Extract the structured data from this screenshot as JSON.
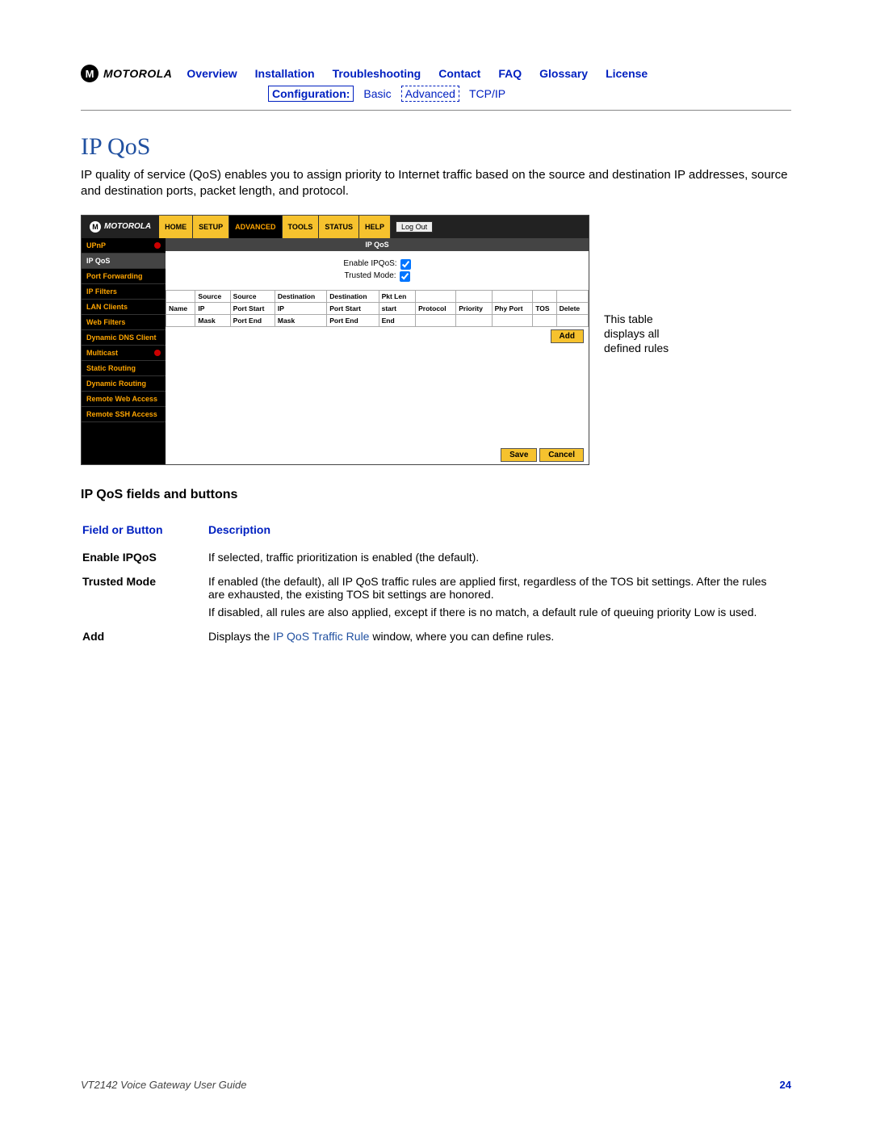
{
  "brand": "MOTOROLA",
  "top_nav": [
    "Overview",
    "Installation",
    "Troubleshooting",
    "Contact",
    "FAQ",
    "Glossary",
    "License"
  ],
  "sub_nav": {
    "label": "Configuration:",
    "basic": "Basic",
    "advanced": "Advanced",
    "tcpip": "TCP/IP"
  },
  "title": "IP QoS",
  "intro": "IP quality of service (QoS) enables you to assign priority to Internet traffic based on the source and destination IP addresses, source and destination ports, packet length, and protocol.",
  "shot": {
    "tabs": [
      "HOME",
      "SETUP",
      "ADVANCED",
      "TOOLS",
      "STATUS",
      "HELP"
    ],
    "active_tab": 2,
    "logout": "Log Out",
    "sidebar": [
      {
        "label": "UPnP",
        "dot": true,
        "sel": false
      },
      {
        "label": "IP QoS",
        "dot": false,
        "sel": true
      },
      {
        "label": "Port Forwarding",
        "dot": false,
        "sel": false
      },
      {
        "label": "IP Filters",
        "dot": false,
        "sel": false
      },
      {
        "label": "LAN Clients",
        "dot": false,
        "sel": false
      },
      {
        "label": "Web Filters",
        "dot": false,
        "sel": false
      },
      {
        "label": "Dynamic DNS Client",
        "dot": false,
        "sel": false
      },
      {
        "label": "Multicast",
        "dot": true,
        "sel": false
      },
      {
        "label": "Static Routing",
        "dot": false,
        "sel": false
      },
      {
        "label": "Dynamic Routing",
        "dot": false,
        "sel": false
      },
      {
        "label": "Remote Web Access",
        "dot": false,
        "sel": false
      },
      {
        "label": "Remote SSH Access",
        "dot": false,
        "sel": false
      }
    ],
    "panel_title": "IP QoS",
    "form": {
      "enable_label": "Enable IPQoS:",
      "trusted_label": "Trusted Mode:"
    },
    "table_headers_row1": [
      "",
      "Source",
      "Source",
      "Destination",
      "Destination",
      "Pkt Len",
      "",
      "",
      "",
      "",
      ""
    ],
    "table_headers_row2": [
      "Name",
      "IP",
      "Port Start",
      "IP",
      "Port Start",
      "start",
      "Protocol",
      "Priority",
      "Phy Port",
      "TOS",
      "Delete"
    ],
    "table_headers_row3": [
      "",
      "Mask",
      "Port End",
      "Mask",
      "Port End",
      "End",
      "",
      "",
      "",
      "",
      ""
    ],
    "buttons": {
      "add": "Add",
      "save": "Save",
      "cancel": "Cancel"
    }
  },
  "side_note": "This table displays all defined rules",
  "section_head": "IP QoS fields  and buttons",
  "field_hdr": {
    "c1": "Field or Button",
    "c2": "Description"
  },
  "fields": {
    "enable": {
      "name": "Enable IPQoS",
      "desc": "If selected, traffic prioritization is enabled (the default)."
    },
    "trusted": {
      "name": "Trusted Mode",
      "p1": "If enabled (the default), all IP QoS traffic rules are applied first, regardless of the TOS bit settings. After the rules are exhausted, the existing TOS bit settings are honored.",
      "p2": "If disabled, all rules are also applied, except if there is no match, a default rule of queuing priority Low is used."
    },
    "add": {
      "name": "Add",
      "pre": "Displays the ",
      "link": "IP QoS Traffic Rule",
      "post": " window, where you can define rules."
    }
  },
  "footer": {
    "title": "VT2142 Voice Gateway User Guide",
    "page": "24"
  }
}
